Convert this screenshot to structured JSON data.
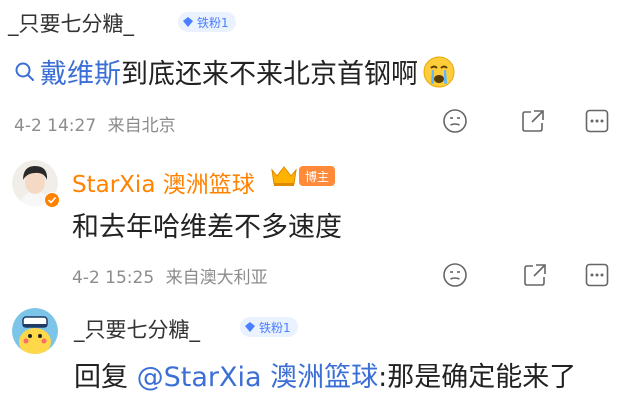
{
  "post": {
    "author": "_只要七分糖_",
    "badge": "铁粉1",
    "topic": "戴维斯",
    "text": "到底还来不来北京首钢啊",
    "timestamp": "4-2 14:27",
    "location": "来自北京"
  },
  "reply1": {
    "author": "StarXia 澳洲篮球",
    "role_badge": "博主",
    "text": "和去年哈维差不多速度",
    "timestamp": "4-2 15:25",
    "location": "来自澳大利亚"
  },
  "reply2": {
    "author": "_只要七分糖_",
    "badge": "铁粉1",
    "prefix": "回复 ",
    "mention": "@StarXia 澳洲篮球",
    "text": ":那是确定能来了"
  },
  "colors": {
    "accent_orange": "#ff8200",
    "link_blue": "#3b6fd6",
    "badge_bg": "#eaf1ff"
  }
}
